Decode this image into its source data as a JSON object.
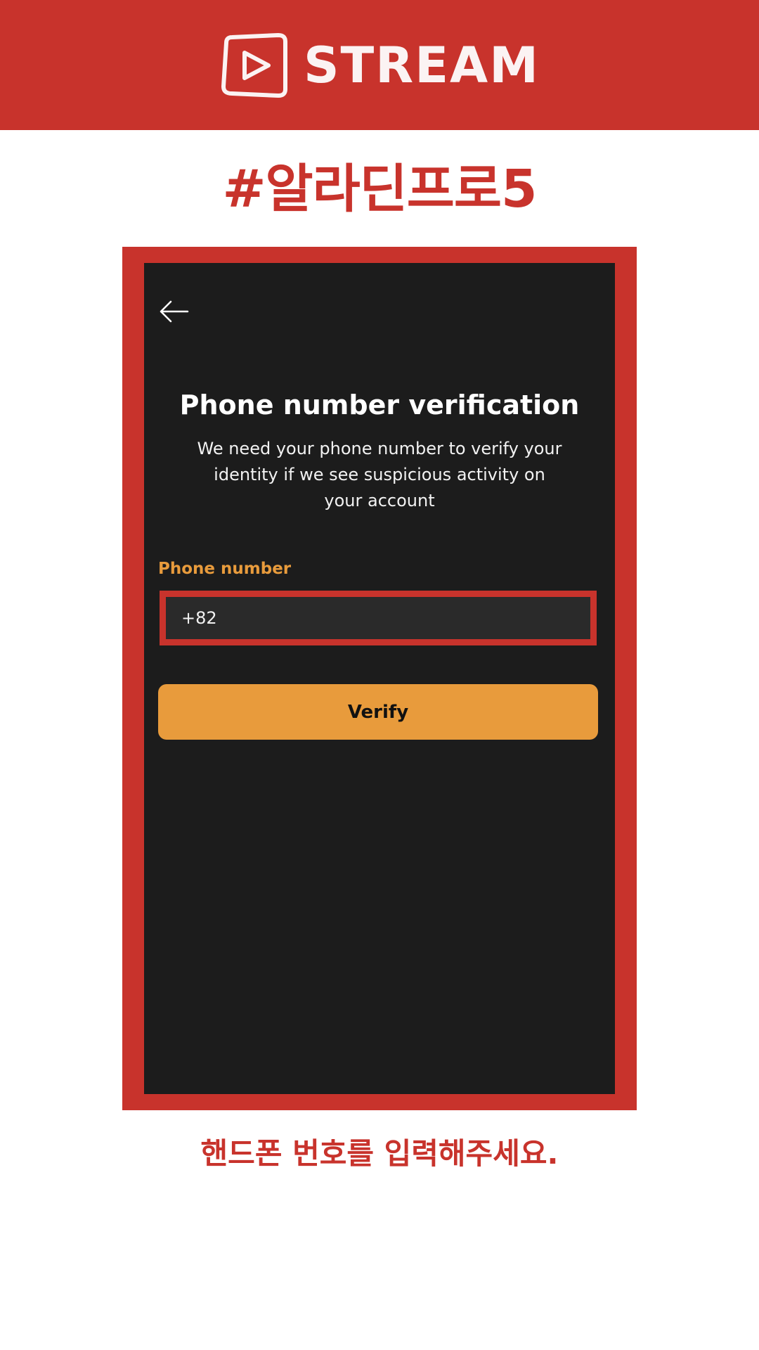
{
  "banner": {
    "brand": "STREAM",
    "logo_icon": "play-button-icon"
  },
  "hashtag": "#알라딘프로5",
  "screen": {
    "back_icon": "arrow-left-icon",
    "title": "Phone number verification",
    "description": "We need your phone number to verify your identity if we see suspicious activity on your account",
    "phone_label": "Phone number",
    "phone_value": "+82",
    "verify_label": "Verify"
  },
  "caption": "핸드폰 번호를 입력해주세요.",
  "colors": {
    "brand_red": "#c8332c",
    "accent_orange": "#e89b3c",
    "screen_bg": "#1c1c1c",
    "input_bg": "#2a2a2a"
  }
}
